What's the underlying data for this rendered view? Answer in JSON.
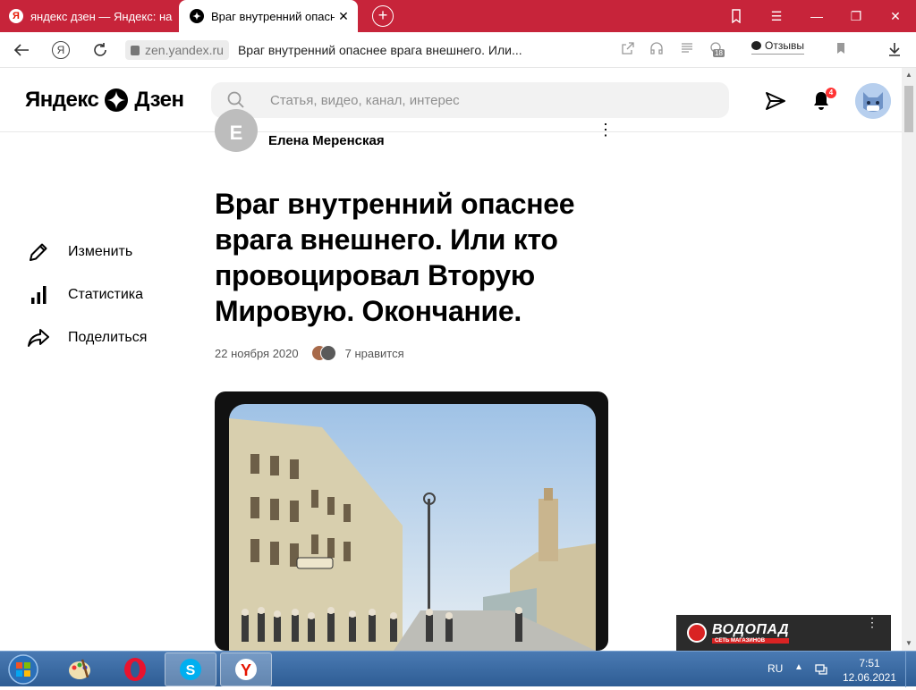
{
  "browser": {
    "tabs": [
      {
        "title": "яндекс дзен — Яндекс: на",
        "favicon": "Я",
        "active": false
      },
      {
        "title": "Враг внутренний опасне",
        "favicon": "✦",
        "active": true
      }
    ],
    "address": {
      "domain": "zen.yandex.ru",
      "page_title": "Враг внутренний опаснее врага внешнего. Или..."
    },
    "reviews_label": "Отзывы",
    "extension_badge": "18"
  },
  "zen": {
    "logo_left": "Яндекс",
    "logo_right": "Дзен",
    "search_placeholder": "Статья, видео, канал, интерес",
    "notifications_count": "4"
  },
  "article": {
    "author_initial": "Е",
    "author_name": "Елена Меренская",
    "title": "Враг внутренний опаснее врага внешнего. Или кто провоцировал Вторую Мировую. Окончание.",
    "date": "22 ноября 2020",
    "likes": "7 нравится"
  },
  "side_menu": [
    {
      "label": "Изменить",
      "icon": "pencil-icon"
    },
    {
      "label": "Статистика",
      "icon": "stats-icon"
    },
    {
      "label": "Поделиться",
      "icon": "share-icon"
    }
  ],
  "ad": {
    "brand": "ВОДОПАД",
    "tagline": "СЕТЬ МАГАЗИНОВ"
  },
  "taskbar": {
    "lang": "RU",
    "time": "7:51",
    "date": "12.06.2021"
  },
  "colors": {
    "tabbar": "#c7243a",
    "search_bg": "#f2f2f2",
    "badge": "#ff3333"
  }
}
